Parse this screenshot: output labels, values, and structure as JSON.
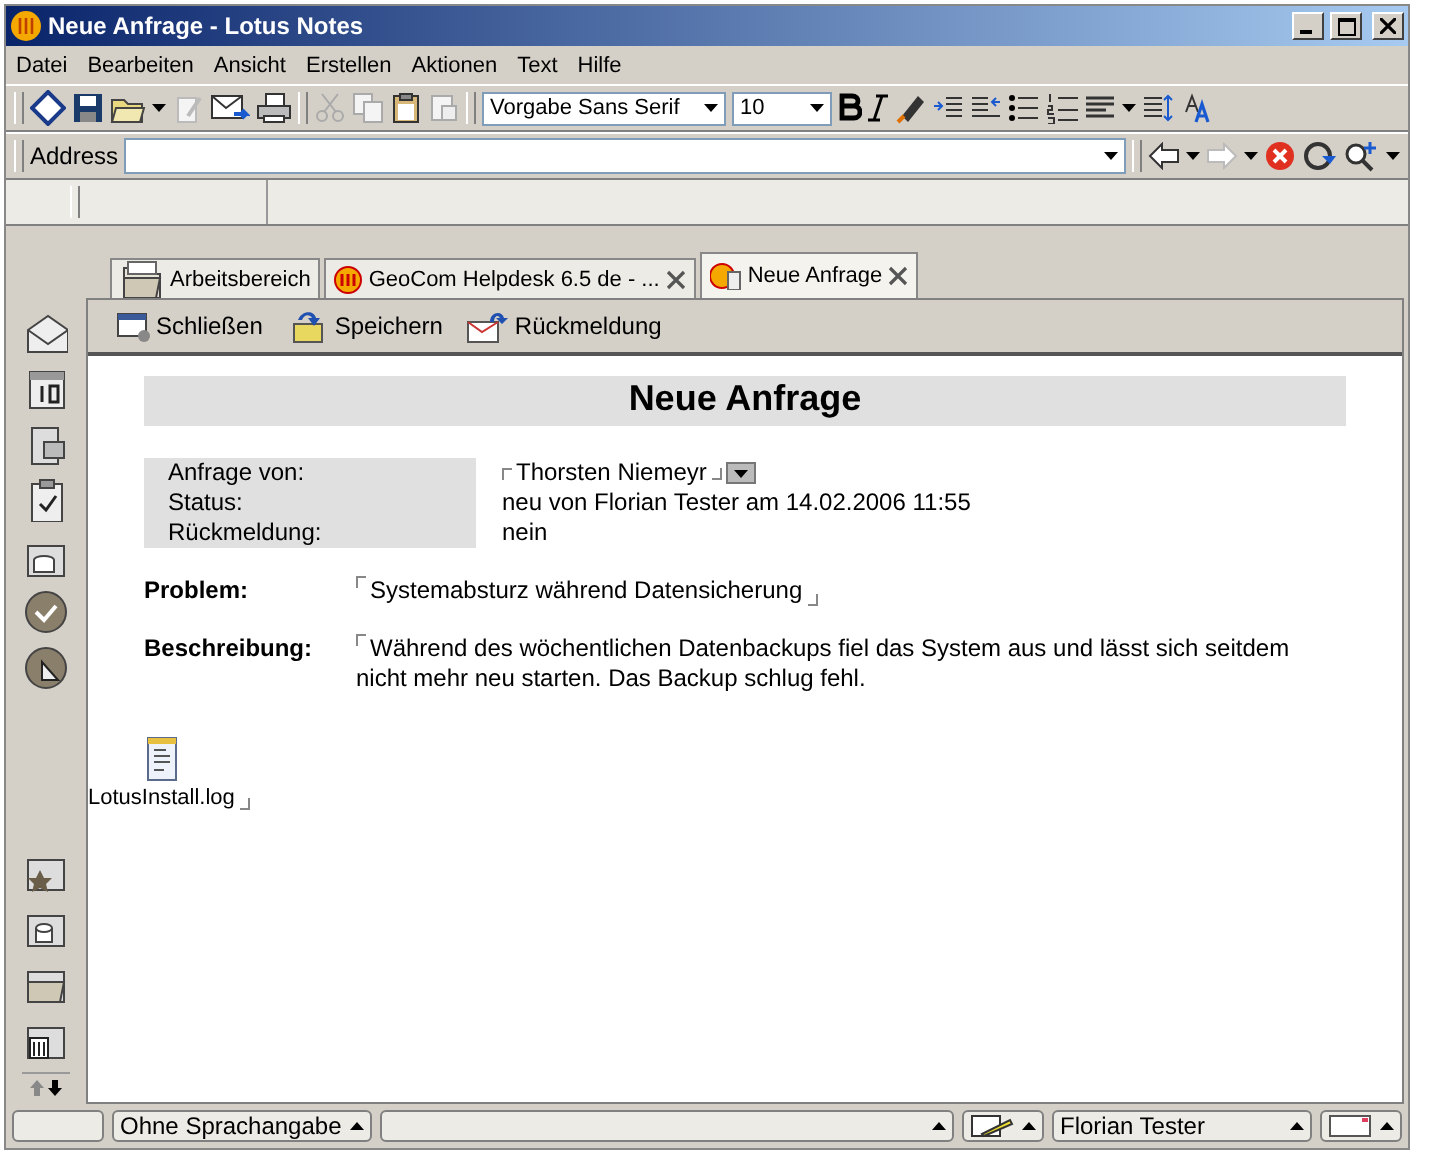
{
  "window": {
    "title": "Neue Anfrage - Lotus Notes"
  },
  "menu": [
    "Datei",
    "Bearbeiten",
    "Ansicht",
    "Erstellen",
    "Aktionen",
    "Text",
    "Hilfe"
  ],
  "toolbar": {
    "font": "Vorgabe Sans Serif",
    "size": "10"
  },
  "address": {
    "label": "Address"
  },
  "tabs": [
    {
      "label": "Arbeitsbereich",
      "selected": false,
      "closable": false,
      "kind": "workspace"
    },
    {
      "label": "GeoCom Helpdesk 6.5 de - ...",
      "selected": false,
      "closable": true,
      "kind": "database"
    },
    {
      "label": "Neue Anfrage",
      "selected": true,
      "closable": true,
      "kind": "document"
    }
  ],
  "actions": [
    {
      "label": "Schließen",
      "kind": "close"
    },
    {
      "label": "Speichern",
      "kind": "save"
    },
    {
      "label": "Rückmeldung",
      "kind": "reply"
    }
  ],
  "form": {
    "heading": "Neue Anfrage",
    "meta": [
      {
        "label": "Anfrage von:",
        "value": "Thorsten Niemeyr",
        "editable": true
      },
      {
        "label": "Status:",
        "value": "neu von Florian Tester am 14.02.2006 11:55",
        "editable": false
      },
      {
        "label": "Rückmeldung:",
        "value": "nein",
        "editable": false
      }
    ],
    "fields": [
      {
        "label": "Problem:",
        "value": "Systemabsturz während Datensicherung"
      },
      {
        "label": "Beschreibung:",
        "value": "Während des wöchentlichen Datenbackups fiel das System aus und lässt sich seitdem nicht mehr neu starten. Das Backup schlug fehl."
      }
    ],
    "attachment": {
      "name": "LotusInstall.log"
    }
  },
  "status_bar": {
    "language": "Ohne Sprachangabe",
    "user": "Florian Tester"
  }
}
